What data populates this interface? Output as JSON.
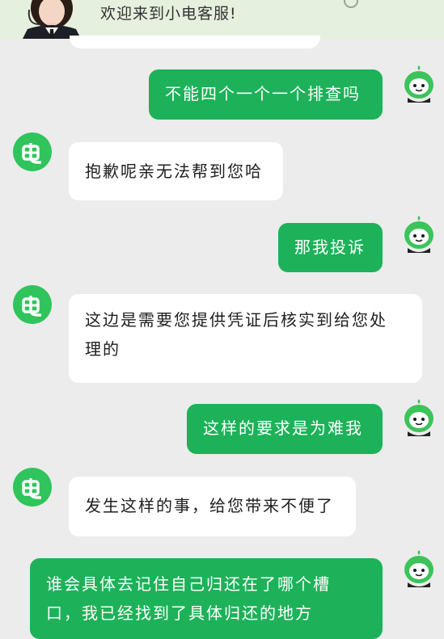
{
  "header": {
    "welcome_text": "欢迎来到小电客服!"
  },
  "colors": {
    "user_bubble": "#1db259",
    "bot_bubble": "#ffffff",
    "background": "#ececec",
    "bot_avatar": "#2fc45c"
  },
  "messages": [
    {
      "from": "user",
      "text": "不能四个一个一个排查吗"
    },
    {
      "from": "bot",
      "text": "抱歉呢亲无法帮到您哈"
    },
    {
      "from": "user",
      "text": "那我投诉"
    },
    {
      "from": "bot",
      "text": "这边是需要您提供凭证后核实到给您处理的"
    },
    {
      "from": "user",
      "text": "这样的要求是为难我"
    },
    {
      "from": "bot",
      "text": "发生这样的事，给您带来不便了"
    },
    {
      "from": "user",
      "text": "谁会具体去记住自己归还在了哪个槽口，我已经找到了具体归还的地方"
    }
  ],
  "icons": {
    "bot_avatar": "lightning-plug-logo-icon",
    "user_avatar": "green-mascot-avatar-icon",
    "agent_avatar": "customer-service-agent-avatar"
  }
}
